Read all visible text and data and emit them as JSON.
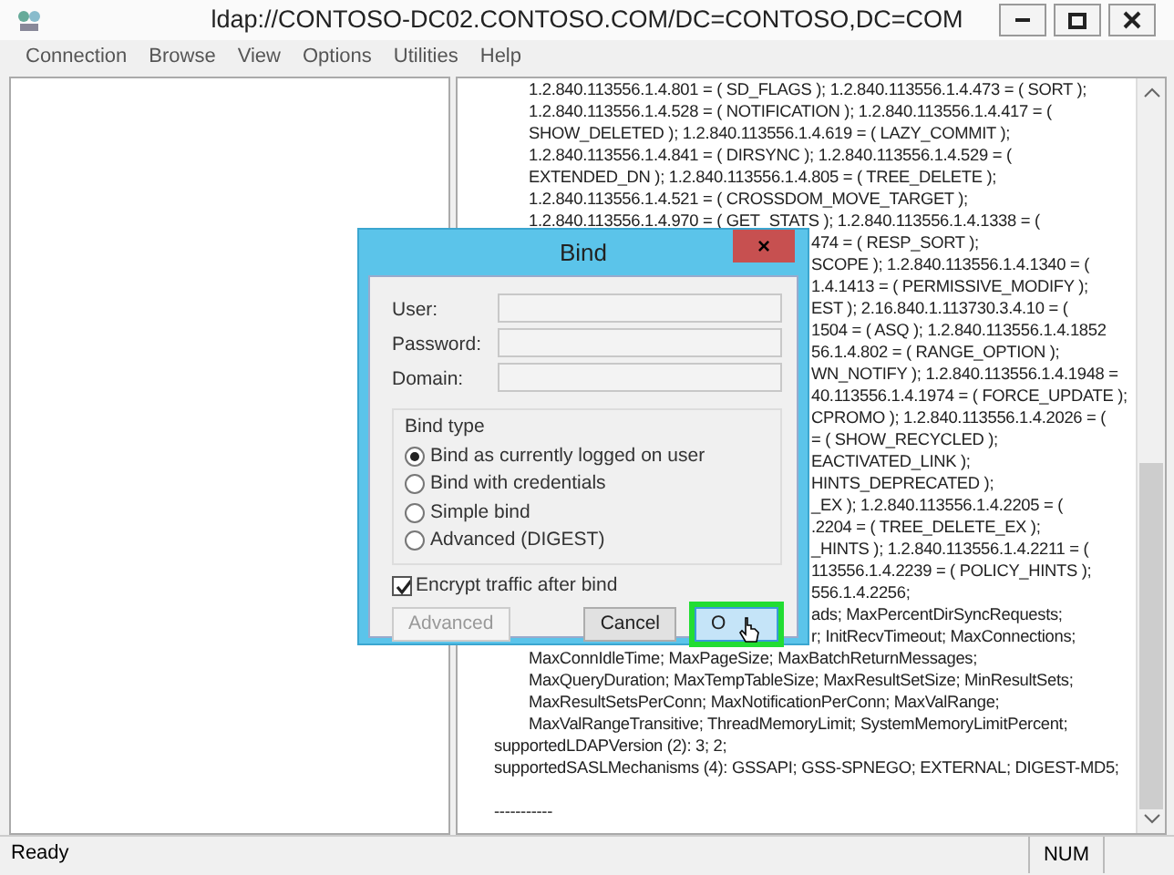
{
  "window": {
    "title": "ldap://CONTOSO-DC02.CONTOSO.COM/DC=CONTOSO,DC=COM"
  },
  "menu": [
    "Connection",
    "Browse",
    "View",
    "Options",
    "Utilities",
    "Help"
  ],
  "output_lines": [
    {
      "kind": "value",
      "text": "1.2.840.113556.1.4.801 = ( SD_FLAGS ); 1.2.840.113556.1.4.473 = ( SORT );"
    },
    {
      "kind": "value",
      "text": "1.2.840.113556.1.4.528 = ( NOTIFICATION ); 1.2.840.113556.1.4.417 = ("
    },
    {
      "kind": "value",
      "text": "SHOW_DELETED ); 1.2.840.113556.1.4.619 = ( LAZY_COMMIT );"
    },
    {
      "kind": "value",
      "text": "1.2.840.113556.1.4.841 = ( DIRSYNC ); 1.2.840.113556.1.4.529 = ("
    },
    {
      "kind": "value",
      "text": "EXTENDED_DN ); 1.2.840.113556.1.4.805 = ( TREE_DELETE );"
    },
    {
      "kind": "value",
      "text": "1.2.840.113556.1.4.521 = ( CROSSDOM_MOVE_TARGET );"
    },
    {
      "kind": "value",
      "text": "1.2.840.113556.1.4.970 = ( GET_STATS ); 1.2.840.113556.1.4.1338 = ("
    },
    {
      "kind": "covered",
      "text": "474 = ( RESP_SORT );"
    },
    {
      "kind": "covered",
      "text": "SCOPE ); 1.2.840.113556.1.4.1340 = ("
    },
    {
      "kind": "covered",
      "text": "1.4.1413 = ( PERMISSIVE_MODIFY );"
    },
    {
      "kind": "covered",
      "text": "EST ); 2.16.840.1.113730.3.4.10 = ("
    },
    {
      "kind": "covered",
      "text": "1504 = ( ASQ ); 1.2.840.113556.1.4.1852"
    },
    {
      "kind": "covered",
      "text": "56.1.4.802 = ( RANGE_OPTION );"
    },
    {
      "kind": "covered",
      "text": "WN_NOTIFY ); 1.2.840.113556.1.4.1948 ="
    },
    {
      "kind": "covered",
      "text": "40.113556.1.4.1974 = ( FORCE_UPDATE );"
    },
    {
      "kind": "covered",
      "text": "CPROMO ); 1.2.840.113556.1.4.2026 = ("
    },
    {
      "kind": "covered",
      "text": "= ( SHOW_RECYCLED );"
    },
    {
      "kind": "covered",
      "text": "EACTIVATED_LINK );"
    },
    {
      "kind": "covered",
      "text": "HINTS_DEPRECATED );"
    },
    {
      "kind": "covered",
      "text": "_EX ); 1.2.840.113556.1.4.2205 = ("
    },
    {
      "kind": "covered",
      "text": ".2204 = ( TREE_DELETE_EX );"
    },
    {
      "kind": "covered",
      "text": "_HINTS ); 1.2.840.113556.1.4.2211 = ("
    },
    {
      "kind": "covered",
      "text": "113556.1.4.2239 = ( POLICY_HINTS );"
    },
    {
      "kind": "covered",
      "text": "556.1.4.2256;"
    },
    {
      "kind": "covered",
      "text": "ads; MaxPercentDirSyncRequests;"
    },
    {
      "kind": "covered",
      "text": "r; InitRecvTimeout; MaxConnections;"
    },
    {
      "kind": "value",
      "text": "MaxConnIdleTime; MaxPageSize; MaxBatchReturnMessages;"
    },
    {
      "kind": "value",
      "text": "MaxQueryDuration; MaxTempTableSize; MaxResultSetSize; MinResultSets;"
    },
    {
      "kind": "value",
      "text": "MaxResultSetsPerConn; MaxNotificationPerConn; MaxValRange;"
    },
    {
      "kind": "value",
      "text": "MaxValRangeTransitive; ThreadMemoryLimit; SystemMemoryLimitPercent;"
    },
    {
      "kind": "attribute",
      "text": "supportedLDAPVersion (2): 3; 2;"
    },
    {
      "kind": "attribute",
      "text": "supportedSASLMechanisms (4): GSSAPI; GSS-SPNEGO; EXTERNAL; DIGEST-MD5;"
    },
    {
      "kind": "blank"
    },
    {
      "kind": "attribute",
      "text": "-----------"
    }
  ],
  "dialog": {
    "title": "Bind",
    "close": "×",
    "fields": [
      {
        "label": "User:"
      },
      {
        "label": "Password:"
      },
      {
        "label": "Domain:"
      }
    ],
    "group_label": "Bind type",
    "options": [
      {
        "label": "Bind as currently logged on user",
        "selected": true
      },
      {
        "label": "Bind with credentials",
        "selected": false
      },
      {
        "label": "Simple bind",
        "selected": false
      },
      {
        "label": "Advanced (DIGEST)",
        "selected": false
      }
    ],
    "checkbox": {
      "label": "Encrypt traffic after bind",
      "checked": true
    },
    "buttons": [
      {
        "label": "Advanced",
        "disabled": true,
        "highlighted": false
      },
      {
        "label": "Cancel",
        "disabled": false,
        "highlighted": false
      },
      {
        "label": "O",
        "disabled": false,
        "highlighted": true
      }
    ]
  },
  "status_bar": {
    "text": "Ready",
    "indicator": "NUM"
  }
}
